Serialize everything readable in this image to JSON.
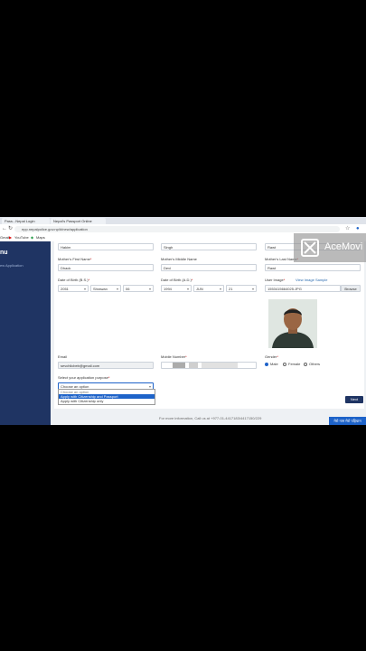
{
  "browser": {
    "tabs": [
      "Pass...Nepal Login",
      "Nepal's Passport Online"
    ],
    "url": "epp.nepalpolice.gov.np/#/new/application",
    "bookmarks": [
      "Gmail",
      "YouTube",
      "Maps"
    ]
  },
  "sidebar": {
    "title": "nu",
    "item": "ew Application"
  },
  "form": {
    "row0": {
      "first": "Hakim",
      "middle": "Singh",
      "last": "Rawt"
    },
    "mother": {
      "first_label": "Mother's First Name",
      "first_value": "Dhack",
      "middle_label": "Mother's Middle Name",
      "middle_value": "Devi",
      "last_label": "Mother's Last Name",
      "last_value": "Rawt"
    },
    "dob_bs": {
      "label": "Date of Birth (B.S.)",
      "year": "2051",
      "month": "Shrawan",
      "day": "06"
    },
    "dob_ad": {
      "label": "Date of Birth (A.D.)",
      "year": "1994",
      "month": "JUN",
      "day": "21"
    },
    "user_image": {
      "label": "User Image",
      "sample_link": "View Image Sample",
      "file_name": "1553415664025.JPG",
      "browse_label": "Browse"
    },
    "email": {
      "label": "Email",
      "value": "sevchlicbeb@gmail.com"
    },
    "mobile": {
      "label": "Mobile Number"
    },
    "gender": {
      "label": "Gender",
      "options": [
        "Male",
        "Female",
        "Others"
      ],
      "selected": "Male"
    },
    "purpose": {
      "label": "Select your application purpose",
      "placeholder": "Choose an option",
      "options": [
        "Choose an option",
        "Apply with Citizenship and Passport",
        "Apply with Citizenship only"
      ],
      "highlighted": "Apply with Citizenship and Passport"
    },
    "next_label": "Next",
    "footer_note": "For more information, Call us at +977-01-4417183/4417150/229"
  },
  "overlays": {
    "watermark": "AceMovi",
    "nepali_badge": "मेरो नाम मेरो पहिचान"
  },
  "colors": {
    "sidebar": "#1f3463",
    "accent": "#1e63c9"
  }
}
